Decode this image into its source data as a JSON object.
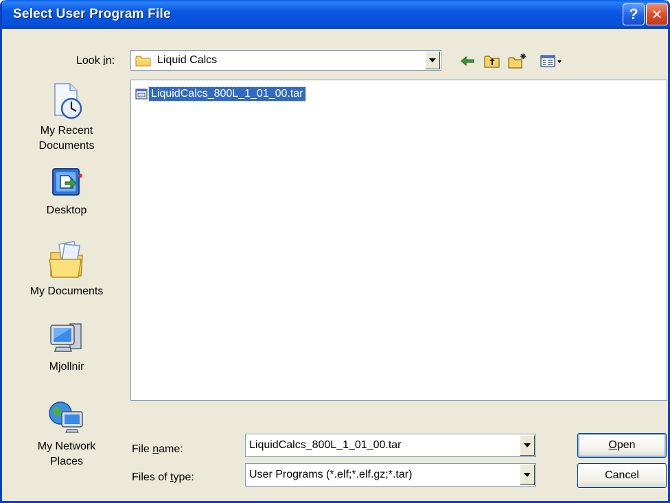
{
  "dialog": {
    "title": "Select User Program File",
    "help_glyph": "?",
    "close_glyph": "✕"
  },
  "lookin": {
    "label_pre": "Look ",
    "label_accel": "i",
    "label_post": "n:",
    "value": "Liquid Calcs"
  },
  "toolbar": {
    "back_icon": "back-arrow-icon",
    "up_icon": "up-folder-icon",
    "newfolder_icon": "new-folder-icon",
    "views_icon": "views-menu-icon"
  },
  "places": [
    {
      "line1": "My Recent",
      "line2": "Documents",
      "icon": "recent-documents-icon"
    },
    {
      "line1": "Desktop",
      "line2": "",
      "icon": "desktop-icon"
    },
    {
      "line1": "My Documents",
      "line2": "",
      "icon": "my-documents-icon"
    },
    {
      "line1": "Mjollnir",
      "line2": "",
      "icon": "my-computer-icon"
    },
    {
      "line1": "My Network",
      "line2": "Places",
      "icon": "network-places-icon"
    }
  ],
  "files": [
    {
      "name": "LiquidCalcs_800L_1_01_00.tar",
      "selected": true
    }
  ],
  "filename": {
    "label_pre": "File ",
    "label_accel": "n",
    "label_post": "ame:",
    "value": "LiquidCalcs_800L_1_01_00.tar"
  },
  "filetype": {
    "label_pre": "Files of ",
    "label_accel": "t",
    "label_post": "ype:",
    "value": "User Programs (*.elf;*.elf.gz;*.tar)"
  },
  "buttons": {
    "open_accel": "O",
    "open_rest": "pen",
    "cancel": "Cancel"
  },
  "colors": {
    "title_blue": "#0550d8",
    "selection": "#316ac5",
    "dialog_bg": "#ece9d8"
  }
}
